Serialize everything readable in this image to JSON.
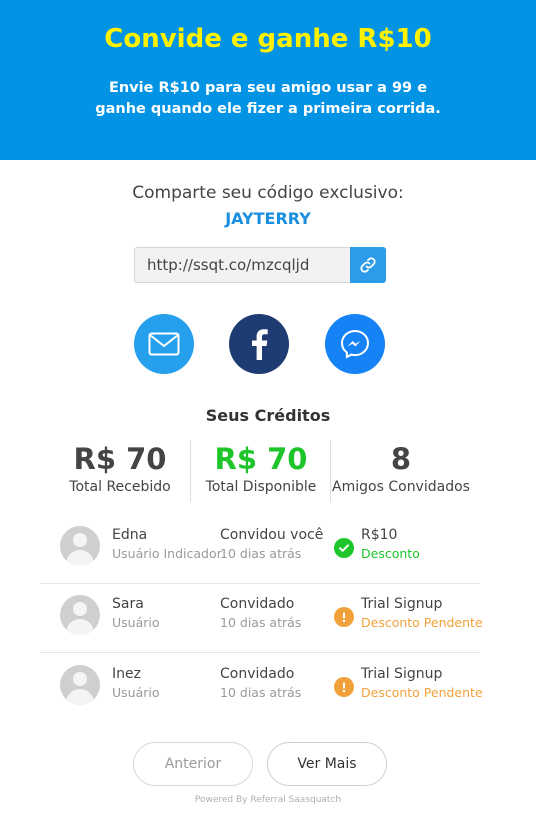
{
  "header": {
    "title": "Convide e ganhe R$10",
    "line1": "Envie R$10 para seu amigo usar a 99 e",
    "line2": "ganhe quando ele fizer a primeira corrida."
  },
  "share": {
    "label": "Comparte seu código exclusivo:",
    "code": "JAYTERRY",
    "link": "http://ssqt.co/mzcqljd"
  },
  "social": {
    "email_icon": "envelope-icon",
    "facebook_icon": "facebook-icon",
    "messenger_icon": "messenger-icon"
  },
  "credits": {
    "title": "Seus Créditos",
    "stats": [
      {
        "value": "R$ 70",
        "label": "Total Recebido"
      },
      {
        "value": "R$ 70",
        "label": "Total Disponible"
      },
      {
        "value": "8",
        "label": "Amigos Convidados"
      }
    ]
  },
  "referrals": [
    {
      "name": "Edna",
      "role": "Usuário Indicador",
      "action": "Convidou você",
      "time": "10 dias atrás",
      "status": "R$10",
      "status_sub": "Desconto",
      "status_type": "ok"
    },
    {
      "name": "Sara",
      "role": "Usuário",
      "action": "Convidado",
      "time": "10 dias atrás",
      "status": "Trial Signup",
      "status_sub": "Desconto Pendente",
      "status_type": "pending"
    },
    {
      "name": "Inez",
      "role": "Usuário",
      "action": "Convidado",
      "time": "10 dias atrás",
      "status": "Trial Signup",
      "status_sub": "Desconto Pendente",
      "status_type": "pending"
    }
  ],
  "pagination": {
    "prev": "Anterior",
    "more": "Ver Mais"
  },
  "footer": "Powered By Referral Saasquatch",
  "colors": {
    "header_bg": "#0393e5",
    "title": "#fff200",
    "accent_green": "#1dc52a",
    "accent_orange": "#f0a13a",
    "code_blue": "#1a8fe0"
  }
}
